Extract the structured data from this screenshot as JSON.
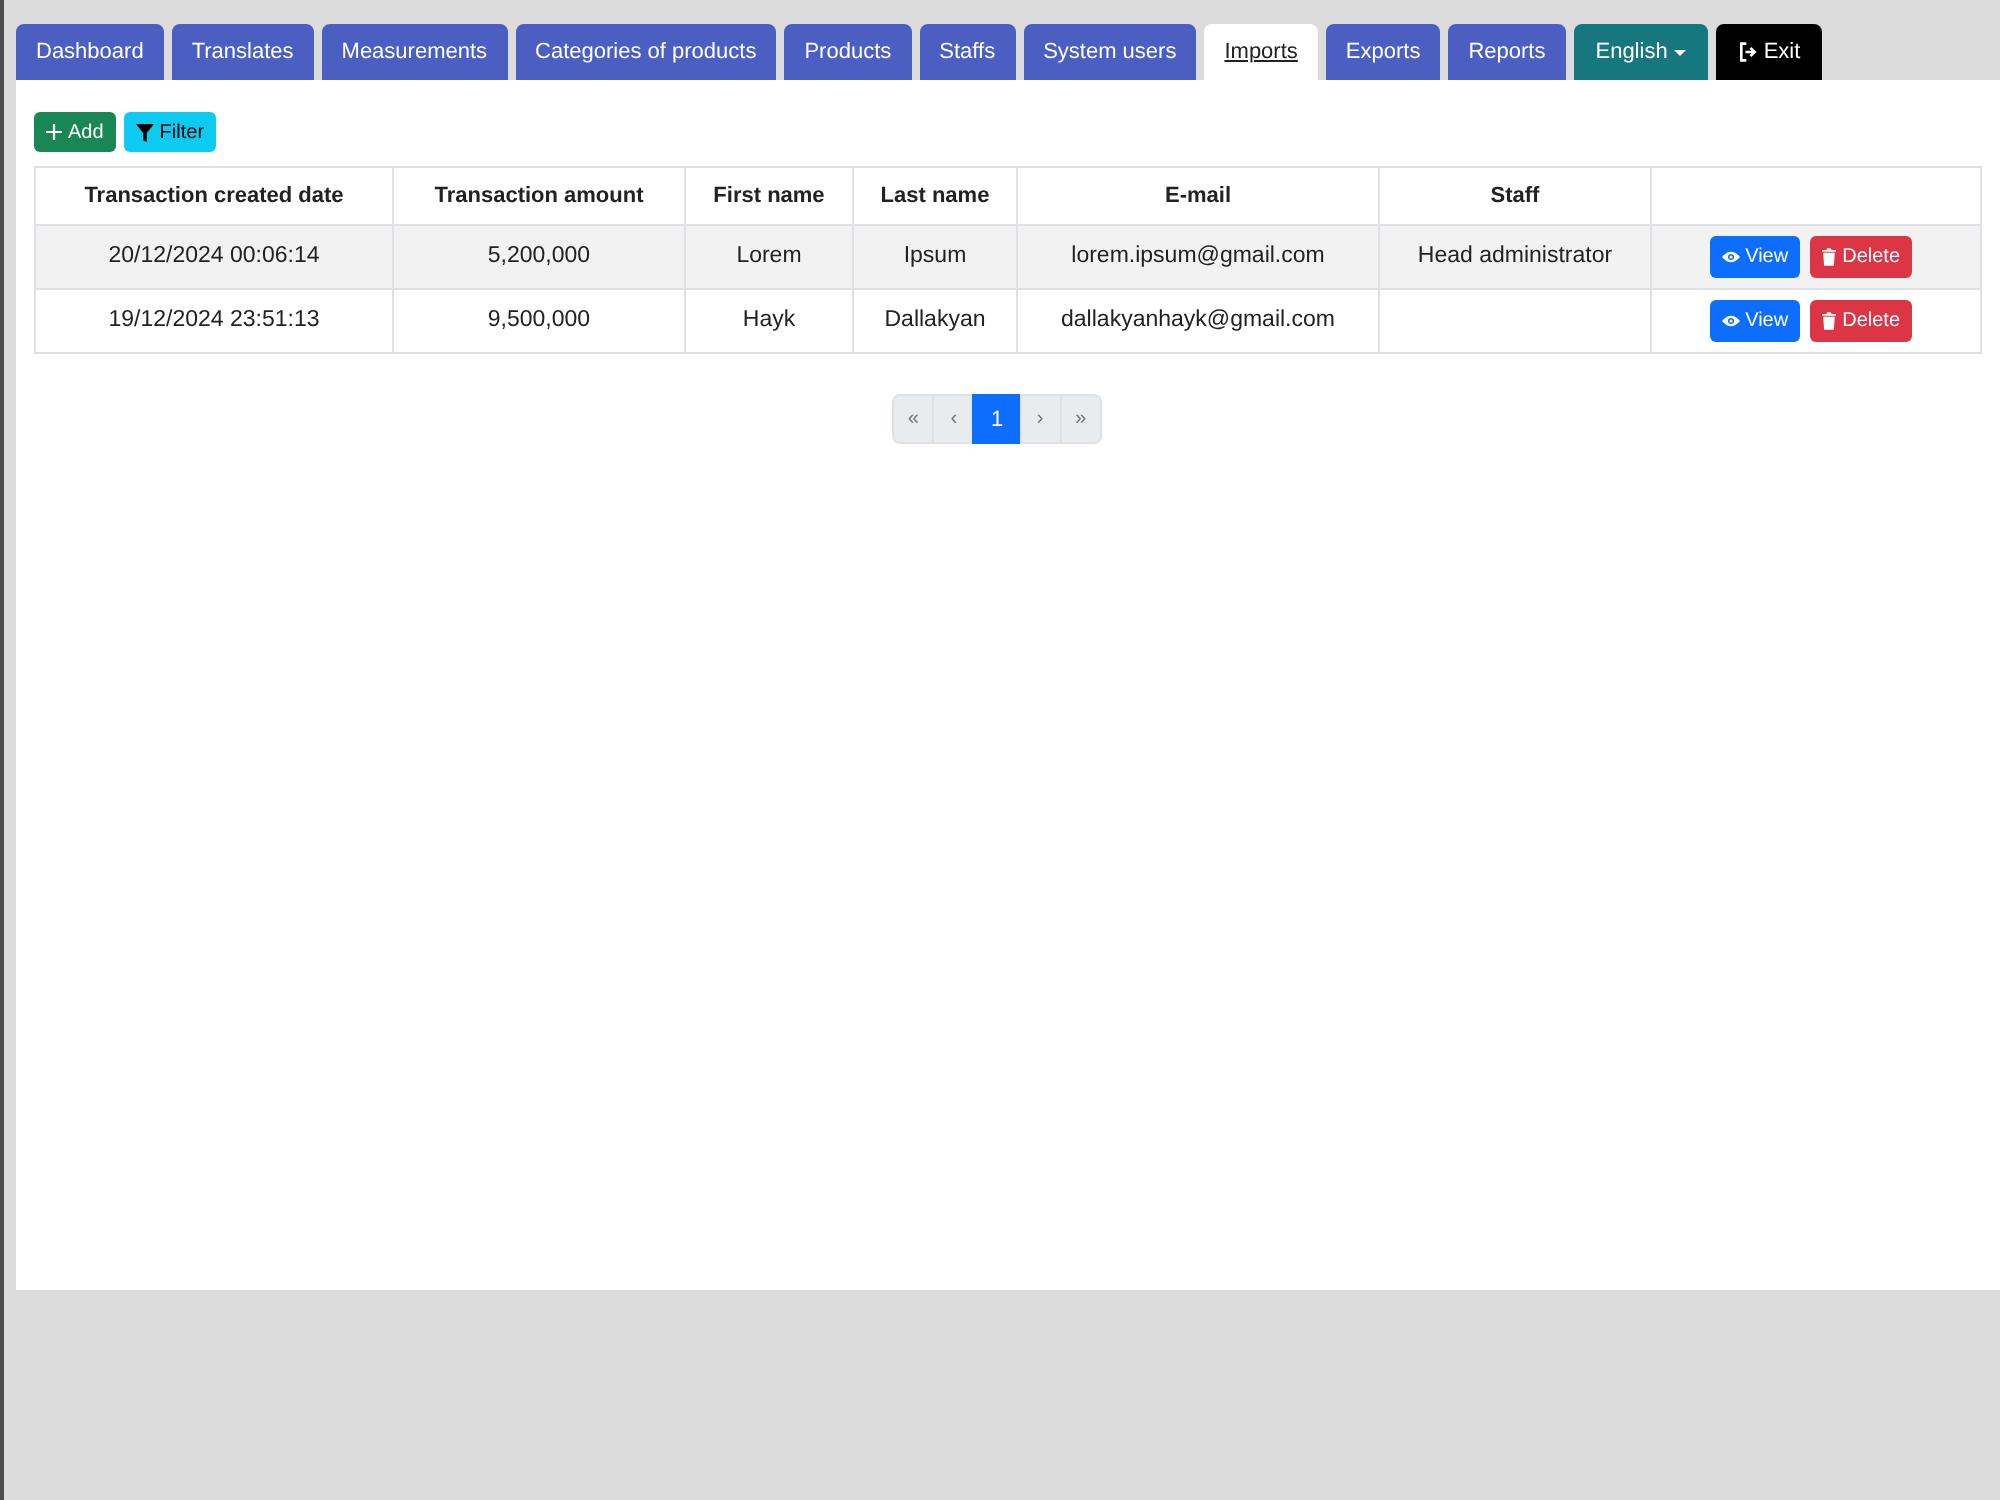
{
  "tabs": [
    {
      "label": "Dashboard",
      "selected": false
    },
    {
      "label": "Translates",
      "selected": false
    },
    {
      "label": "Measurements",
      "selected": false
    },
    {
      "label": "Categories of products",
      "selected": false
    },
    {
      "label": "Products",
      "selected": false
    },
    {
      "label": "Staffs",
      "selected": false
    },
    {
      "label": "System users",
      "selected": false
    },
    {
      "label": "Imports",
      "selected": true
    },
    {
      "label": "Exports",
      "selected": false
    },
    {
      "label": "Reports",
      "selected": false
    }
  ],
  "language_menu": {
    "label": "English"
  },
  "exit_button": {
    "label": "Exit"
  },
  "toolbar": [
    {
      "label": "Add",
      "kind": "add"
    },
    {
      "label": "Filter",
      "kind": "filter"
    }
  ],
  "table": {
    "columns": [
      "Transaction created date",
      "Transaction amount",
      "First name",
      "Last name",
      "E-mail",
      "Staff"
    ],
    "rows": [
      {
        "created": "20/12/2024 00:06:14",
        "amount": "5,200,000",
        "first_name": "Lorem",
        "last_name": "Ipsum",
        "email": "lorem.ipsum@gmail.com",
        "staff": "Head administrator",
        "actions": [
          {
            "label": "View",
            "kind": "view"
          },
          {
            "label": "Delete",
            "kind": "delete"
          }
        ]
      },
      {
        "created": "19/12/2024 23:51:13",
        "amount": "9,500,000",
        "first_name": "Hayk",
        "last_name": "Dallakyan",
        "email": "dallakyanhayk@gmail.com",
        "actions": [
          {
            "label": "View",
            "kind": "view"
          },
          {
            "label": "Delete",
            "kind": "delete"
          }
        ]
      }
    ]
  },
  "pagination": [
    {
      "label": "«",
      "selected": false,
      "disabled": true
    },
    {
      "label": "‹",
      "selected": false,
      "disabled": true
    },
    {
      "label": "1",
      "selected": true,
      "disabled": false
    },
    {
      "label": "›",
      "selected": false,
      "disabled": true
    },
    {
      "label": "»",
      "selected": false,
      "disabled": true
    }
  ]
}
